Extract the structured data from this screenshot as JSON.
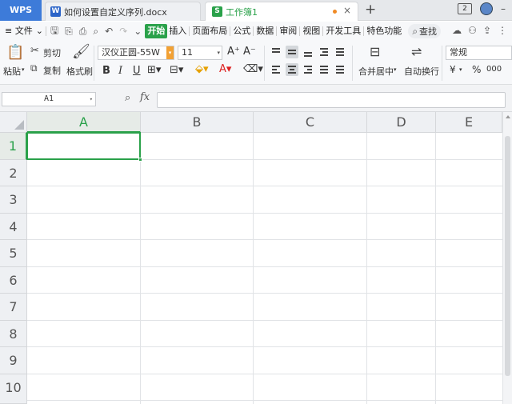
{
  "tabs": {
    "app": "WPS",
    "doc": {
      "icon": "W",
      "title": "如何设置自定义序列.docx"
    },
    "sheet": {
      "icon": "S",
      "title": "工作簿1"
    },
    "new_tab": "+",
    "window_count": "2"
  },
  "menu": {
    "file": "≡ 文件",
    "file_arrow": "⌄",
    "items": [
      "开始",
      "插入",
      "页面布局",
      "公式",
      "数据",
      "审阅",
      "视图",
      "开发工具",
      "特色功能"
    ],
    "search": "查找"
  },
  "ribbon": {
    "paste": "粘贴",
    "cut": "剪切",
    "copy": "复制",
    "format_painter": "格式刷",
    "font_name": "汉仪正圆-55W",
    "font_size": "11",
    "merge_center": "合并居中",
    "wrap_text": "自动换行",
    "number_format": "常规",
    "currency": "¥",
    "percent": "%",
    "thousands": "000"
  },
  "formula_bar": {
    "name_box": "A1",
    "fx": "fx",
    "value": ""
  },
  "grid": {
    "columns": [
      "A",
      "B",
      "C",
      "D",
      "E"
    ],
    "rows": [
      "1",
      "2",
      "3",
      "4",
      "5",
      "6",
      "7",
      "8",
      "9",
      "10"
    ],
    "active_cell": "A1"
  },
  "colors": {
    "accent_green": "#2aa14a",
    "wps_blue": "#3d7bd9",
    "orange": "#f2a134"
  }
}
